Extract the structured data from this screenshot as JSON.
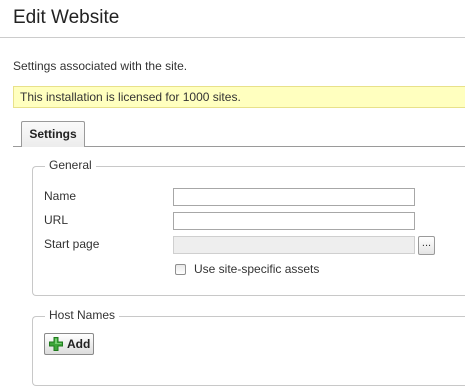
{
  "page": {
    "title": "Edit Website",
    "description": "Settings associated with the site.",
    "license_notice": "This installation is licensed for 1000 sites."
  },
  "tabs": [
    {
      "label": "Settings",
      "active": true
    }
  ],
  "general": {
    "legend": "General",
    "name_label": "Name",
    "name_value": "",
    "url_label": "URL",
    "url_value": "",
    "start_page_label": "Start page",
    "start_page_value": "",
    "browse_label": "...",
    "assets_checkbox_label": "Use site-specific assets",
    "assets_checked": false
  },
  "host_names": {
    "legend": "Host Names",
    "add_label": "Add",
    "add_icon": "plus-icon"
  },
  "colors": {
    "license_background": "#ffffbf",
    "add_icon_green": "#3ea63a"
  }
}
